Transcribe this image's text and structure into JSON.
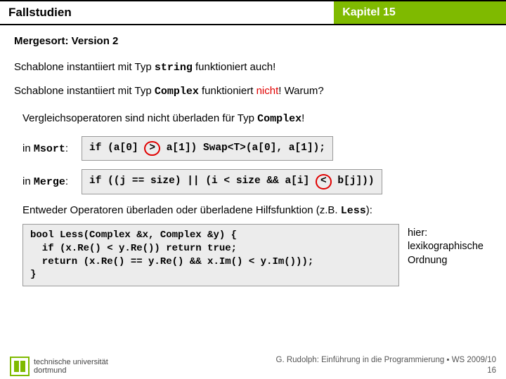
{
  "header": {
    "left": "Fallstudien",
    "right": "Kapitel 15"
  },
  "subtitle": "Mergesort: Version 2",
  "line_string_a": "Schablone instantiiert mit Typ ",
  "line_string_type": "string",
  "line_string_b": " funktioniert auch!",
  "line_complex_a": "Schablone instantiiert mit Typ ",
  "line_complex_type": "Complex",
  "line_complex_b": " funktioniert ",
  "line_complex_nicht": "nicht",
  "line_complex_c": "!  Warum?",
  "comp_a": "Vergleichsoperatoren sind nicht überladen für Typ ",
  "comp_type": "Complex",
  "comp_b": "!",
  "labels": {
    "msort_pre": "in ",
    "msort_m": "Msort",
    "msort_post": ":",
    "merge_pre": "in ",
    "merge_m": "Merge",
    "merge_post": ":"
  },
  "msort_code": {
    "a": "if (a[0] ",
    "op": ">",
    "b": " a[1]) Swap<T>(a[0], a[1]);"
  },
  "merge_code": {
    "a": "if ((j == size) || (i < size && a[i] ",
    "op": "<",
    "b": " b[j]))"
  },
  "conclusion_a": "Entweder Operatoren überladen oder überladene Hilfsfunktion (z.B. ",
  "conclusion_m": "Less",
  "conclusion_b": "):",
  "less_code": "bool Less(Complex &x, Complex &y) {\n  if (x.Re() < y.Re()) return true;\n  return (x.Re() == y.Re() && x.Im() < y.Im()));\n}",
  "side_note": {
    "a": "hier:",
    "b": "lexikographische",
    "c": "Ordnung"
  },
  "footer": {
    "uni1": "technische universität",
    "uni2": "dortmund",
    "credit": "G. Rudolph: Einführung in die Programmierung ▪ WS 2009/10",
    "page": "16"
  }
}
